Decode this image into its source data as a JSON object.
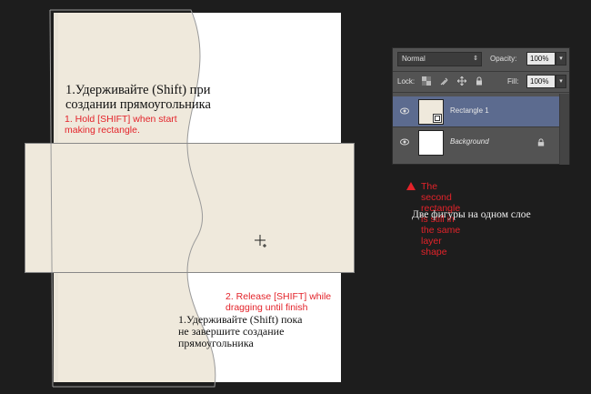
{
  "canvas": {
    "step1_ru": "1.Удерживайте (Shift) при\nсоздании прямоугольника",
    "step1_en": "1. Hold [SHIFT] when start\nmaking rectangle.",
    "step2_en": "2. Release [SHIFT] while\ndragging until finish",
    "step2_ru": "1.Удерживайте (Shift) пока\nне завершите создание\nпрямоугольника",
    "crosshair_icon": "crosshair-cursor",
    "shape_fill_color": "#efe9dc"
  },
  "layers_panel": {
    "blend_mode": "Normal",
    "opacity_label": "Opacity:",
    "opacity_value": "100%",
    "lock_label": "Lock:",
    "fill_label": "Fill:",
    "fill_value": "100%",
    "layers": [
      {
        "name": "Rectangle 1",
        "selected": true,
        "icon": "shape-layer-thumbnail"
      },
      {
        "name": "Background",
        "selected": false,
        "icon": "white-thumbnail",
        "locked": true
      }
    ]
  },
  "note": {
    "en": "The second rectangle is still in\nthe same layer shape",
    "ru": "Две фигуры на одном слое",
    "accent_color": "#e3232a"
  }
}
